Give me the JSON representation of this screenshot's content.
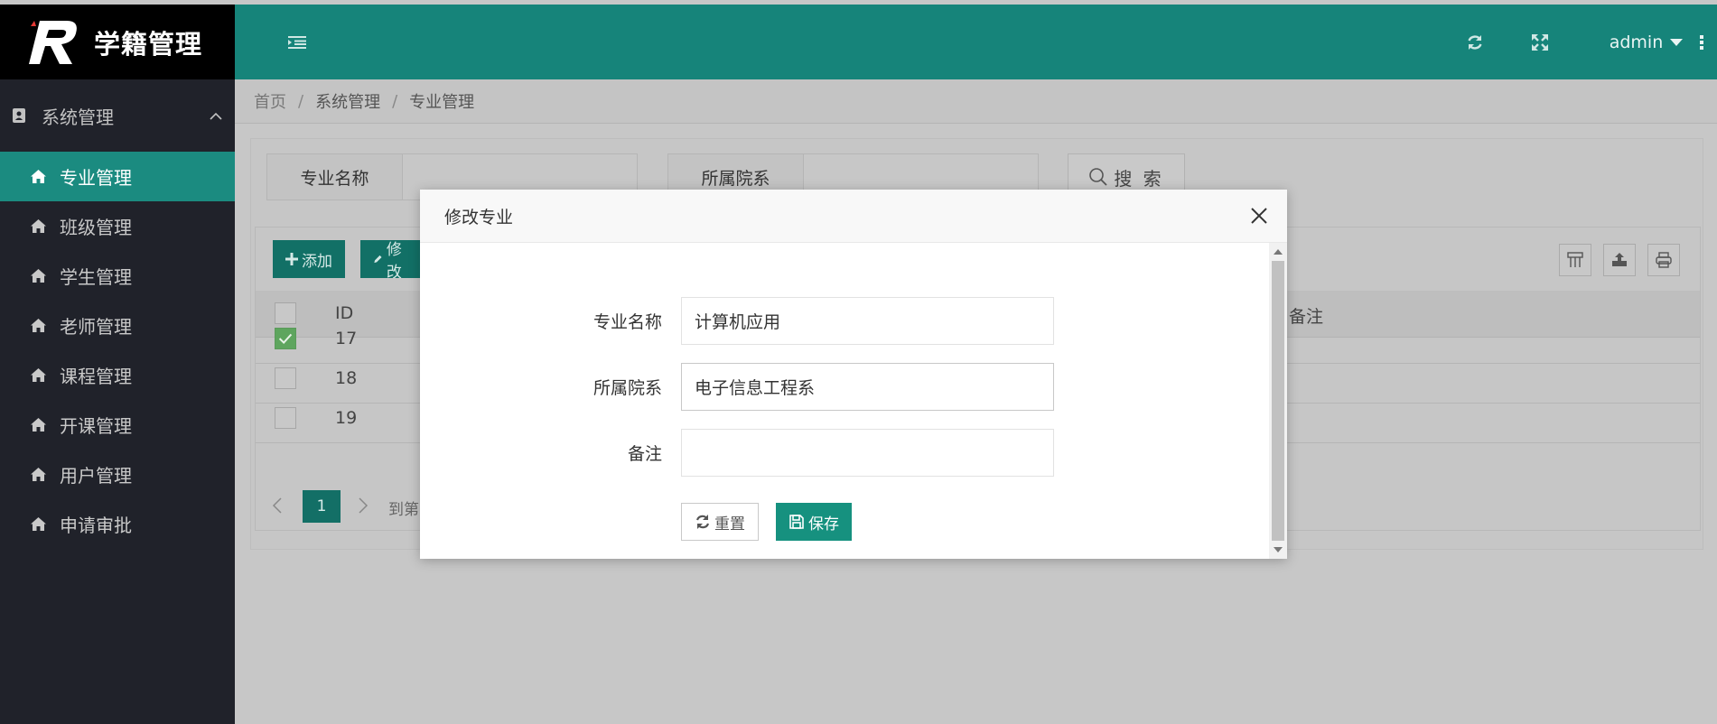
{
  "app": {
    "title": "学籍管理"
  },
  "sidebar": {
    "group_label": "系统管理",
    "items": [
      {
        "label": "专业管理",
        "active": true
      },
      {
        "label": "班级管理",
        "active": false
      },
      {
        "label": "学生管理",
        "active": false
      },
      {
        "label": "老师管理",
        "active": false
      },
      {
        "label": "课程管理",
        "active": false
      },
      {
        "label": "开课管理",
        "active": false
      },
      {
        "label": "用户管理",
        "active": false
      },
      {
        "label": "申请审批",
        "active": false
      }
    ]
  },
  "header": {
    "user": "admin"
  },
  "breadcrumb": [
    "首页",
    "系统管理",
    "专业管理"
  ],
  "search": {
    "fields": [
      {
        "label": "专业名称",
        "value": ""
      },
      {
        "label": "所属院系",
        "value": ""
      }
    ],
    "button_label": "搜 索"
  },
  "toolbar": {
    "add_label": "添加",
    "edit_label": "修改"
  },
  "table": {
    "headers": [
      "ID",
      "备注"
    ],
    "rows": [
      {
        "id": "17",
        "checked": true
      },
      {
        "id": "18",
        "checked": false
      },
      {
        "id": "19",
        "checked": false
      }
    ]
  },
  "pagination": {
    "current_page": "1",
    "goto_text": "到第"
  },
  "modal": {
    "title": "修改专业",
    "fields": [
      {
        "label": "专业名称",
        "value": "计算机应用"
      },
      {
        "label": "所属院系",
        "value": "电子信息工程系"
      },
      {
        "label": "备注",
        "value": ""
      }
    ],
    "reset_label": "重置",
    "save_label": "保存"
  },
  "colors": {
    "primary": "#16847a",
    "active_nav": "#1b8b80",
    "sidebar_bg": "#20222a",
    "save_button": "#16917f"
  }
}
